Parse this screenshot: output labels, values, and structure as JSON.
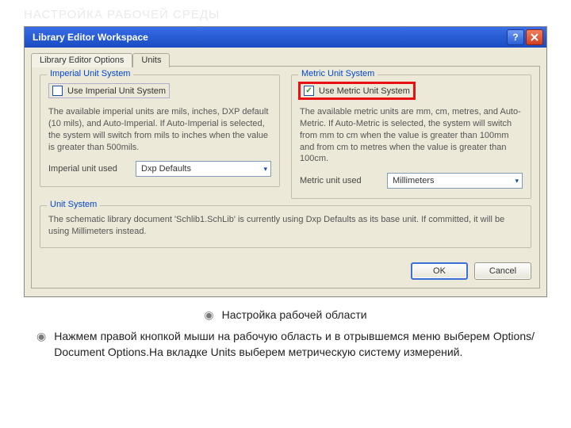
{
  "slide_title": "НАСТРОЙКА РАБОЧЕЙ СРЕДЫ",
  "window": {
    "title": "Library Editor Workspace"
  },
  "tabs": {
    "options": "Library Editor Options",
    "units": "Units"
  },
  "imperial": {
    "legend": "Imperial Unit System",
    "checkbox": "Use Imperial Unit System",
    "desc": "The available imperial units are mils, inches, DXP default (10 mils), and Auto-Imperial. If Auto-Imperial is selected, the system will switch from mils to inches when the value is greater than 500mils.",
    "label": "Imperial unit used",
    "value": "Dxp Defaults"
  },
  "metric": {
    "legend": "Metric Unit System",
    "checkbox": "Use Metric Unit System",
    "desc": "The available metric units are mm, cm, metres, and Auto-Metric. If Auto-Metric is selected, the system will switch from mm to cm when the value is greater than 100mm and from cm to metres when the value is greater than 100cm.",
    "label": "Metric unit used",
    "value": "Millimeters"
  },
  "unitsys": {
    "legend": "Unit System",
    "text": "The schematic library document 'Schlib1.SchLib' is currently using Dxp Defaults as its base unit. If committed, it will be using Millimeters instead."
  },
  "buttons": {
    "ok": "OK",
    "cancel": "Cancel"
  },
  "bullets": {
    "b1": "Настройка рабочей области",
    "b2": "Нажмем правой кнопкой мыши на рабочую область и в отрывшемся меню выберем Options/ Document Options.На вкладке Units выберем метрическую систему измерений."
  }
}
